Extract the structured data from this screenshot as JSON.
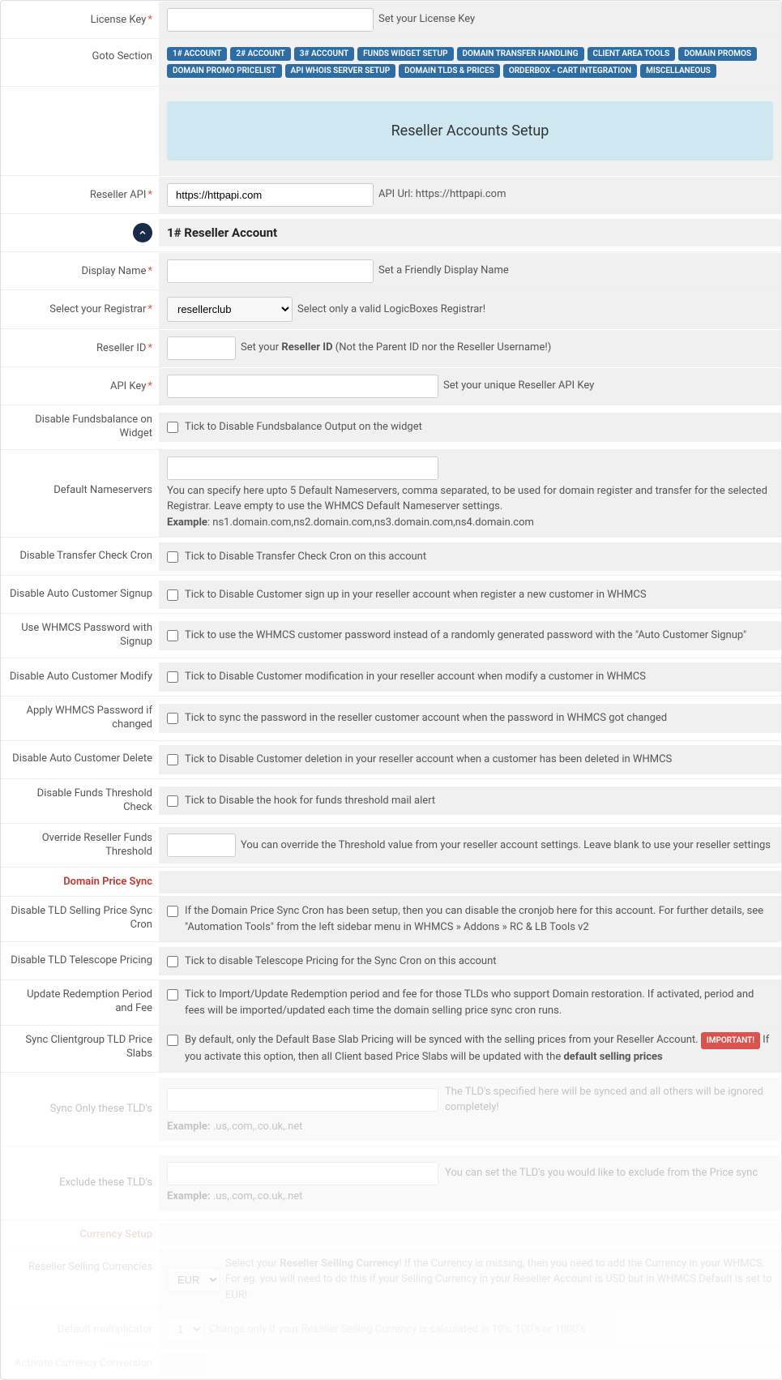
{
  "rows": {
    "licenseKey": {
      "label": "License Key",
      "hint": "Set your License Key"
    },
    "gotoSection": {
      "label": "Goto Section",
      "badges": [
        "1# ACCOUNT",
        "2# ACCOUNT",
        "3# ACCOUNT",
        "FUNDS WIDGET SETUP",
        "DOMAIN TRANSFER HANDLING",
        "CLIENT AREA TOOLS",
        "DOMAIN PROMOS",
        "DOMAIN PROMO PRICELIST",
        "API WHOIS SERVER SETUP",
        "DOMAIN TLDS & PRICES",
        "ORDERBOX - CART INTEGRATION",
        "MISCELLANEOUS"
      ]
    },
    "banner": "Reseller Accounts Setup",
    "resellerApi": {
      "label": "Reseller API",
      "value": "https://httpapi.com",
      "hint": "API Url: https://httpapi.com"
    },
    "sectionHeader": "1# Reseller Account",
    "displayName": {
      "label": "Display Name",
      "hint": "Set a Friendly Display Name"
    },
    "registrar": {
      "label": "Select your Registrar",
      "value": "resellerclub",
      "hint": "Select only a valid LogicBoxes Registrar!"
    },
    "resellerId": {
      "label": "Reseller ID",
      "hint_pre": "Set your ",
      "hint_bold": "Reseller ID",
      "hint_post": " (Not the Parent ID nor the Reseller Username!)"
    },
    "apiKey": {
      "label": "API Key",
      "hint": "Set your unique Reseller API Key"
    },
    "disableFunds": {
      "label": "Disable Fundsbalance on Widget",
      "hint": "Tick to Disable Fundsbalance Output on the widget"
    },
    "defaultNs": {
      "label": "Default Nameservers",
      "desc": "You can specify here upto 5 Default Nameservers, comma separated, to be used for domain register and transfer for the selected Registrar. Leave empty to use the WHMCS Default Nameserver settings.",
      "example_label": "Example",
      "example": "ns1.domain.com,ns2.domain.com,ns3.domain.com,ns4.domain.com"
    },
    "disableTransfer": {
      "label": "Disable Transfer Check Cron",
      "hint": "Tick to Disable Transfer Check Cron on this account"
    },
    "disableSignup": {
      "label": "Disable Auto Customer Signup",
      "hint": "Tick to Disable Customer sign up in your reseller account when register a new customer in WHMCS"
    },
    "whmcsPwSignup": {
      "label": "Use WHMCS Password with Signup",
      "hint": "Tick to use the WHMCS customer password instead of a randomly generated password with the \"Auto Customer Signup\""
    },
    "disableModify": {
      "label": "Disable Auto Customer Modify",
      "hint": "Tick to Disable Customer modification in your reseller account when modify a customer in WHMCS"
    },
    "applyPw": {
      "label": "Apply WHMCS Password if changed",
      "hint": "Tick to sync the password in the reseller customer account when the password in WHMCS got changed"
    },
    "disableDelete": {
      "label": "Disable Auto Customer Delete",
      "hint": "Tick to Disable Customer deletion in your reseller account when a customer has been deleted in WHMCS"
    },
    "disableThreshold": {
      "label": "Disable Funds Threshold Check",
      "hint": "Tick to Disable the hook for funds threshold mail alert"
    },
    "overrideThreshold": {
      "label": "Override Reseller Funds Threshold",
      "hint": "You can override the Threshold value from your reseller account settings. Leave blank to use your reseller settings"
    },
    "domainPriceSync": "Domain Price Sync",
    "disableTldSync": {
      "label": "Disable TLD Selling Price Sync Cron",
      "hint": "If the Domain Price Sync Cron has been setup, then you can disable the cronjob here for this account. For further details, see \"Automation Tools\" from the left sidebar menu in WHMCS » Addons » RC & LB Tools v2"
    },
    "disableTelescope": {
      "label": "Disable TLD Telescope Pricing",
      "hint": "Tick to disable Telescope Pricing for the Sync Cron on this account"
    },
    "redemption": {
      "label": "Update Redemption Period and Fee",
      "hint": "Tick to Import/Update Redemption period and fee for those TLDs who support Domain restoration. If activated, period and fees will be imported/updated each time the domain selling price sync cron runs."
    },
    "slabs": {
      "label": "Sync Clientgroup TLD Price Slabs",
      "pre": "By default, only the Default Base Slab Pricing will be synced with the selling prices from your Reseller Account. ",
      "important": "IMPORTANT!",
      "mid": " If you activate this option, then all Client based Price Slabs will be updated with the ",
      "bold": "default selling prices"
    },
    "syncOnly": {
      "label": "Sync Only these TLD's",
      "hint": "The TLD's specified here will be synced and all others will be ignored completely!",
      "example_label": "Example:",
      "example": " .us,.com,.co.uk,.net"
    },
    "exclude": {
      "label": "Exclude these TLD's",
      "hint": "You can set the TLD's you would like to exclude from the Price sync",
      "example_label": "Example:",
      "example": " .us,.com,.co.uk,.net"
    },
    "currencySetup": "Currency Setup",
    "resellerCurrency": {
      "label": "Reseller Selling Currencies",
      "value": "EUR",
      "hint_pre": "Select your ",
      "hint_bold": "Reseller Selling Currency",
      "hint_post": "! If the Currency is missing, then you need to add the Currency in your WHMCS. For eg. you will need to do this if your Selling Currency in your Reseller Account is USD but in WHMCS Default is set to EUR!"
    },
    "multiplicator": {
      "label": "Default multiplicator",
      "value": "1",
      "hint": "Change only if your Reseller Selling Currency is calculated in 10's, 100's or 1000's"
    },
    "activateConv": {
      "label": "Activate Currency Conversion"
    }
  }
}
